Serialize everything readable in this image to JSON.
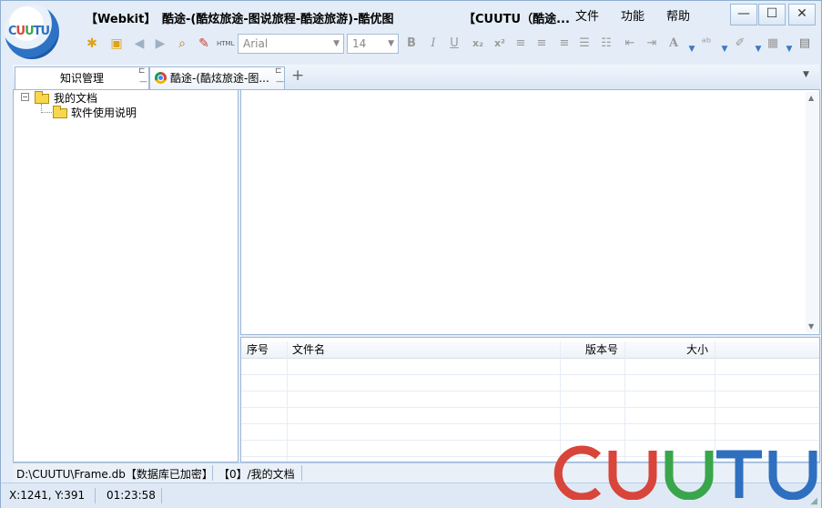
{
  "app": {
    "engine_label": "【Webkit】",
    "title": "酷途-(酷炫旅途-图说旅程-酷途旅游)-酷优图",
    "brand_label": "【CUUTU（酷途...",
    "logo_text": "CUUTU"
  },
  "menu": [
    "文件",
    "功能",
    "帮助"
  ],
  "window_controls": {
    "minimize": "—",
    "maximize": "☐",
    "close": "✕"
  },
  "toolbar": {
    "font_name": "Arial",
    "font_size": "14",
    "bold": "B",
    "italic": "I",
    "underline": "U",
    "subscript": "x₂",
    "superscript": "x²",
    "font_color": "A",
    "html_label": "HTML"
  },
  "tabs": [
    {
      "label": "知识管理"
    },
    {
      "label": "酷途-(酷炫旅途-图..."
    }
  ],
  "tab_add": "+",
  "tree": {
    "root": "我的文档",
    "children": [
      "软件使用说明"
    ]
  },
  "file_table": {
    "columns": [
      "序号",
      "文件名",
      "版本号",
      "大小"
    ],
    "rows": []
  },
  "status_bar": {
    "db_path": "D:\\CUUTU\\Frame.db【数据库已加密】",
    "current_path": "【0】/我的文档",
    "coords": "X:1241, Y:391",
    "time": "01:23:58"
  },
  "watermark": {
    "text": "CUUTU"
  },
  "colors": {
    "frame_bg": "#e4edf7",
    "border": "#9fb8d8",
    "logo_blue": "#2d72c4",
    "wm_red": "#d9453a",
    "wm_green": "#3aa64b",
    "wm_blue": "#2f6fbf"
  }
}
